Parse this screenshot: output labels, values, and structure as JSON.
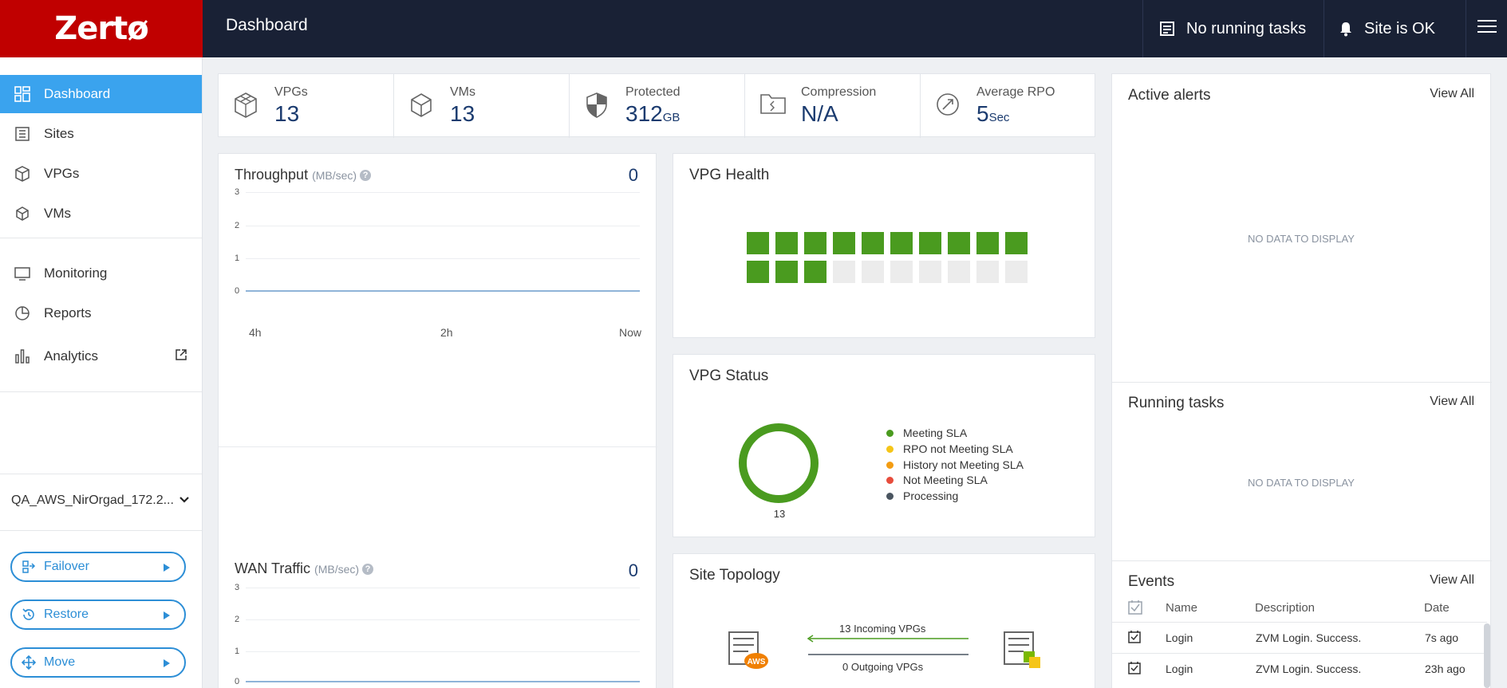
{
  "header": {
    "logo_text": "Zertø",
    "title": "Dashboard",
    "tasks_label": "No running tasks",
    "site_status": "Site is OK"
  },
  "sidebar": {
    "items": [
      {
        "label": "Dashboard",
        "icon": "dashboard-icon"
      },
      {
        "label": "Sites",
        "icon": "sites-icon"
      },
      {
        "label": "VPGs",
        "icon": "vpgs-icon"
      },
      {
        "label": "VMs",
        "icon": "vms-icon"
      },
      {
        "label": "Monitoring",
        "icon": "monitor-icon"
      },
      {
        "label": "Reports",
        "icon": "reports-icon"
      },
      {
        "label": "Analytics",
        "icon": "analytics-icon"
      }
    ],
    "site_selector": "QA_AWS_NirOrgad_172.2...",
    "actions": {
      "failover": "Failover",
      "restore": "Restore",
      "move": "Move"
    }
  },
  "stats": [
    {
      "label": "VPGs",
      "value": "13",
      "unit": ""
    },
    {
      "label": "VMs",
      "value": "13",
      "unit": ""
    },
    {
      "label": "Protected",
      "value": "312",
      "unit": "GB"
    },
    {
      "label": "Compression",
      "value": "N/A",
      "unit": ""
    },
    {
      "label": "Average RPO",
      "value": "5",
      "unit": "Sec"
    }
  ],
  "throughput": {
    "title": "Throughput",
    "unit": "(MB/sec)",
    "value": "0",
    "y_ticks": [
      "3",
      "2",
      "1",
      "0"
    ],
    "x_ticks": [
      "4h",
      "2h",
      "Now"
    ]
  },
  "wan": {
    "title": "WAN Traffic",
    "unit": "(MB/sec)",
    "value": "0",
    "y_ticks": [
      "3",
      "2",
      "1",
      "0"
    ]
  },
  "vpg_health": {
    "title": "VPG Health",
    "healthy": 13,
    "total": 20,
    "color_ok": "#4a9b1f",
    "color_empty": "#ececec"
  },
  "vpg_status": {
    "title": "VPG Status",
    "total": "13",
    "legend": [
      {
        "label": "Meeting SLA",
        "color": "#4a9b1f"
      },
      {
        "label": "RPO not Meeting SLA",
        "color": "#f5c518"
      },
      {
        "label": "History not Meeting SLA",
        "color": "#f39c12"
      },
      {
        "label": "Not Meeting SLA",
        "color": "#e74c3c"
      },
      {
        "label": "Processing",
        "color": "#4a5560"
      }
    ]
  },
  "topology": {
    "title": "Site Topology",
    "incoming": "13 Incoming VPGs",
    "outgoing": "0 Outgoing VPGs",
    "left_badge": "AWS"
  },
  "alerts": {
    "title": "Active alerts",
    "view_all": "View All",
    "empty": "NO DATA TO DISPLAY"
  },
  "running_tasks": {
    "title": "Running tasks",
    "view_all": "View All",
    "empty": "NO DATA TO DISPLAY"
  },
  "events": {
    "title": "Events",
    "view_all": "View All",
    "columns": {
      "name": "Name",
      "description": "Description",
      "date": "Date"
    },
    "rows": [
      {
        "name": "Login",
        "description": "ZVM Login. Success.",
        "date": "7s ago"
      },
      {
        "name": "Login",
        "description": "ZVM Login. Success.",
        "date": "23h ago"
      }
    ]
  }
}
